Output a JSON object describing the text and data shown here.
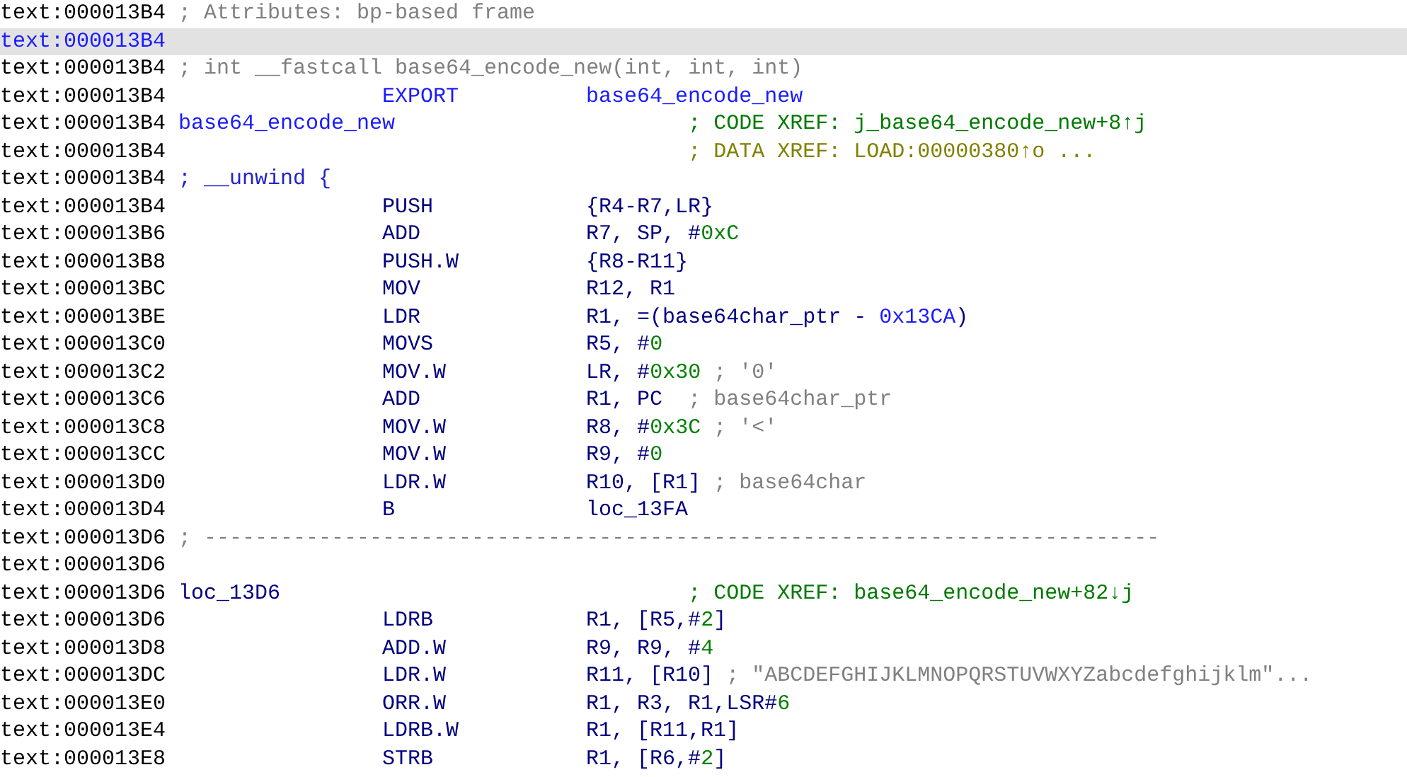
{
  "rows": [
    {
      "address": "text:000013B4",
      "selected": false,
      "comment": {
        "text": "; Attributes: bp-based frame",
        "kind": "note"
      }
    },
    {
      "address": "text:000013B4",
      "selected": true
    },
    {
      "address": "text:000013B4",
      "selected": false,
      "comment": {
        "text": "; int __fastcall base64_encode_new(int, int, int)",
        "kind": "note"
      }
    },
    {
      "address": "text:000013B4",
      "selected": false,
      "mnemonic": {
        "text": "EXPORT",
        "kind": "directive"
      },
      "operands": [
        {
          "text": "base64_encode_new",
          "kind": "name"
        }
      ]
    },
    {
      "address": "text:000013B4",
      "selected": false,
      "label": {
        "text": "base64_encode_new",
        "kind": "func"
      },
      "xref": {
        "text": "; CODE XREF: j_base64_encode_new+8↑j",
        "kind": "code"
      }
    },
    {
      "address": "text:000013B4",
      "selected": false,
      "xref": {
        "text": "; DATA XREF: LOAD:00000380↑o ...",
        "kind": "data"
      }
    },
    {
      "address": "text:000013B4",
      "selected": false,
      "comment": {
        "text": "; __unwind {",
        "kind": "unwind"
      }
    },
    {
      "address": "text:000013B4",
      "selected": false,
      "mnemonic": {
        "text": "PUSH",
        "kind": "insn"
      },
      "operands": [
        {
          "text": "{R4-R7,LR}",
          "kind": "reg"
        }
      ]
    },
    {
      "address": "text:000013B6",
      "selected": false,
      "mnemonic": {
        "text": "ADD",
        "kind": "insn"
      },
      "operands": [
        {
          "text": "R7, SP, #",
          "kind": "reg"
        },
        {
          "text": "0xC",
          "kind": "num"
        }
      ]
    },
    {
      "address": "text:000013B8",
      "selected": false,
      "mnemonic": {
        "text": "PUSH.W",
        "kind": "insn"
      },
      "operands": [
        {
          "text": "{R8-R11}",
          "kind": "reg"
        }
      ]
    },
    {
      "address": "text:000013BC",
      "selected": false,
      "mnemonic": {
        "text": "MOV",
        "kind": "insn"
      },
      "operands": [
        {
          "text": "R12, R1",
          "kind": "reg"
        }
      ]
    },
    {
      "address": "text:000013BE",
      "selected": false,
      "mnemonic": {
        "text": "LDR",
        "kind": "insn"
      },
      "operands": [
        {
          "text": "R1, =(base64char_ptr - ",
          "kind": "reg"
        },
        {
          "text": "0x13CA",
          "kind": "name"
        },
        {
          "text": ")",
          "kind": "reg"
        }
      ]
    },
    {
      "address": "text:000013C0",
      "selected": false,
      "mnemonic": {
        "text": "MOVS",
        "kind": "insn"
      },
      "operands": [
        {
          "text": "R5, #",
          "kind": "reg"
        },
        {
          "text": "0",
          "kind": "num"
        }
      ]
    },
    {
      "address": "text:000013C2",
      "selected": false,
      "mnemonic": {
        "text": "MOV.W",
        "kind": "insn"
      },
      "operands": [
        {
          "text": "LR, #",
          "kind": "reg"
        },
        {
          "text": "0x30",
          "kind": "num"
        },
        {
          "text": " ; '0'",
          "kind": "comment"
        }
      ]
    },
    {
      "address": "text:000013C6",
      "selected": false,
      "mnemonic": {
        "text": "ADD",
        "kind": "insn"
      },
      "operands": [
        {
          "text": "R1, PC",
          "kind": "reg"
        },
        {
          "text": "  ; base64char_ptr",
          "kind": "comment"
        }
      ]
    },
    {
      "address": "text:000013C8",
      "selected": false,
      "mnemonic": {
        "text": "MOV.W",
        "kind": "insn"
      },
      "operands": [
        {
          "text": "R8, #",
          "kind": "reg"
        },
        {
          "text": "0x3C",
          "kind": "num"
        },
        {
          "text": " ; '<'",
          "kind": "comment"
        }
      ]
    },
    {
      "address": "text:000013CC",
      "selected": false,
      "mnemonic": {
        "text": "MOV.W",
        "kind": "insn"
      },
      "operands": [
        {
          "text": "R9, #",
          "kind": "reg"
        },
        {
          "text": "0",
          "kind": "num"
        }
      ]
    },
    {
      "address": "text:000013D0",
      "selected": false,
      "mnemonic": {
        "text": "LDR.W",
        "kind": "insn"
      },
      "operands": [
        {
          "text": "R10, [R1]",
          "kind": "reg"
        },
        {
          "text": " ; base64char",
          "kind": "comment"
        }
      ]
    },
    {
      "address": "text:000013D4",
      "selected": false,
      "mnemonic": {
        "text": "B",
        "kind": "insn"
      },
      "operands": [
        {
          "text": "loc_13FA",
          "kind": "reg"
        }
      ]
    },
    {
      "address": "text:000013D6",
      "selected": false,
      "comment": {
        "text": "; ---------------------------------------------------------------------------",
        "kind": "note"
      }
    },
    {
      "address": "text:000013D6",
      "selected": false
    },
    {
      "address": "text:000013D6",
      "selected": false,
      "label": {
        "text": "loc_13D6",
        "kind": "loc"
      },
      "xref": {
        "text": "; CODE XREF: base64_encode_new+82↓j",
        "kind": "code"
      }
    },
    {
      "address": "text:000013D6",
      "selected": false,
      "mnemonic": {
        "text": "LDRB",
        "kind": "insn"
      },
      "operands": [
        {
          "text": "R1, [R5,#",
          "kind": "reg"
        },
        {
          "text": "2",
          "kind": "num"
        },
        {
          "text": "]",
          "kind": "reg"
        }
      ]
    },
    {
      "address": "text:000013D8",
      "selected": false,
      "mnemonic": {
        "text": "ADD.W",
        "kind": "insn"
      },
      "operands": [
        {
          "text": "R9, R9, #",
          "kind": "reg"
        },
        {
          "text": "4",
          "kind": "num"
        }
      ]
    },
    {
      "address": "text:000013DC",
      "selected": false,
      "mnemonic": {
        "text": "LDR.W",
        "kind": "insn"
      },
      "operands": [
        {
          "text": "R11, [R10]",
          "kind": "reg"
        },
        {
          "text": " ; \"ABCDEFGHIJKLMNOPQRSTUVWXYZabcdefghijklm\"...",
          "kind": "comment"
        }
      ]
    },
    {
      "address": "text:000013E0",
      "selected": false,
      "mnemonic": {
        "text": "ORR.W",
        "kind": "insn"
      },
      "operands": [
        {
          "text": "R1, R3, R1,LSR#",
          "kind": "reg"
        },
        {
          "text": "6",
          "kind": "num"
        }
      ]
    },
    {
      "address": "text:000013E4",
      "selected": false,
      "mnemonic": {
        "text": "LDRB.W",
        "kind": "insn"
      },
      "operands": [
        {
          "text": "R1, [R11,R1]",
          "kind": "reg"
        }
      ]
    },
    {
      "address": "text:000013E8",
      "selected": false,
      "mnemonic": {
        "text": "STRB",
        "kind": "insn"
      },
      "operands": [
        {
          "text": "R1, [R6,#",
          "kind": "reg"
        },
        {
          "text": "2",
          "kind": "num"
        },
        {
          "text": "]",
          "kind": "reg"
        }
      ]
    }
  ]
}
